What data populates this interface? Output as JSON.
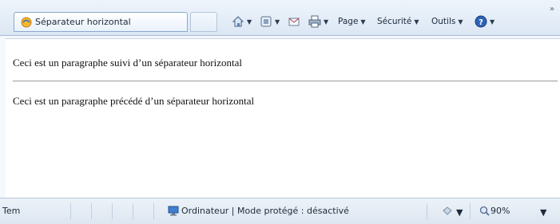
{
  "tab": {
    "title": "Séparateur horizontal",
    "icon": "ie-page-icon"
  },
  "toolbar": {
    "home_icon": "home-icon",
    "feeds_icon": "feeds-icon",
    "mail_icon": "mail-icon",
    "print_icon": "print-icon",
    "page_label": "Page",
    "security_label": "Sécurité",
    "tools_label": "Outils",
    "help_icon": "help-icon",
    "more_icon": "chevron-right-double-icon"
  },
  "content": {
    "paragraph1": "Ceci est un paragraphe suivi d’un séparateur horizontal",
    "paragraph2": "Ceci est un paragraphe précédé d’un séparateur horizontal"
  },
  "statusbar": {
    "status_text": "Tem",
    "zone_text": "Ordinateur | Mode protégé : désactivé",
    "zoom_label": "90%"
  },
  "colors": {
    "accent": "#3a6fb0",
    "window_bg": "#dce7f4"
  }
}
